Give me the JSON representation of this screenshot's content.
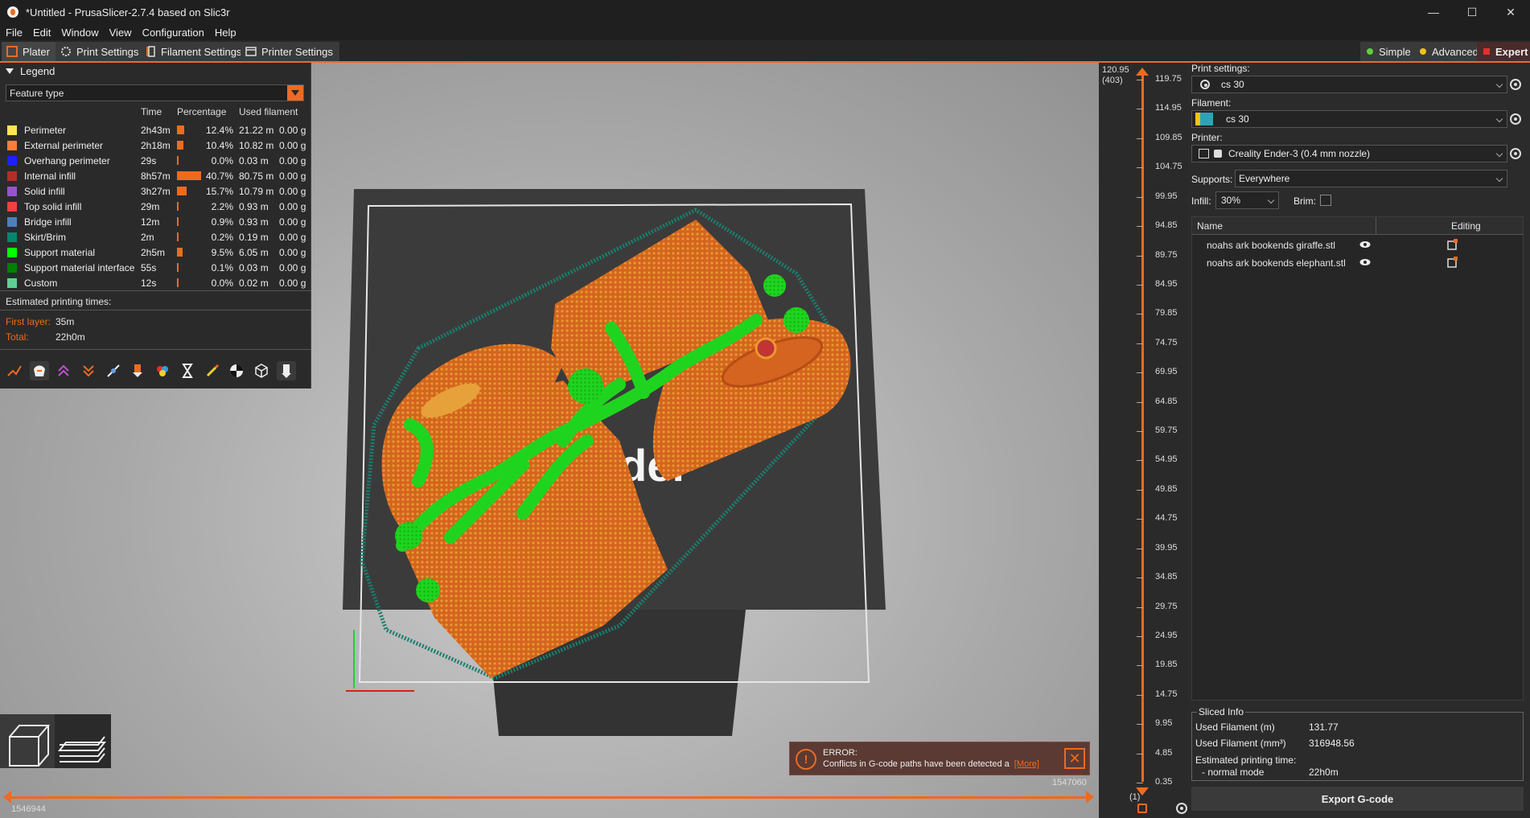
{
  "window": {
    "title": "*Untitled - PrusaSlicer-2.7.4 based on Slic3r",
    "minimize": "—",
    "maximize": "☐",
    "close": "✕"
  },
  "menu": [
    "File",
    "Edit",
    "Window",
    "View",
    "Configuration",
    "Help"
  ],
  "tabs": {
    "plater": "Plater",
    "print_settings": "Print Settings",
    "filament_settings": "Filament Settings",
    "printer_settings": "Printer Settings"
  },
  "modes": {
    "simple": "Simple",
    "advanced": "Advanced",
    "expert": "Expert"
  },
  "colors": {
    "accent": "#ed6b21",
    "simple": "#5fcf3a",
    "advanced": "#f2c21b",
    "expert": "#e03030"
  },
  "legend": {
    "header": "Legend",
    "view_type": "Feature type",
    "columns": {
      "time": "Time",
      "percentage": "Percentage",
      "used_filament": "Used filament"
    },
    "rows": [
      {
        "name": "Perimeter",
        "color": "#ffe64d",
        "time": "2h43m",
        "percent": 12.4,
        "percent_label": "12.4%",
        "length": "21.22 m",
        "weight": "0.00 g"
      },
      {
        "name": "External perimeter",
        "color": "#ff7d38",
        "time": "2h18m",
        "percent": 10.4,
        "percent_label": "10.4%",
        "length": "10.82 m",
        "weight": "0.00 g"
      },
      {
        "name": "Overhang perimeter",
        "color": "#1f1fff",
        "time": "29s",
        "percent": 0.0,
        "percent_label": "0.0%",
        "length": "0.03 m",
        "weight": "0.00 g"
      },
      {
        "name": "Internal infill",
        "color": "#b03029",
        "time": "8h57m",
        "percent": 40.7,
        "percent_label": "40.7%",
        "length": "80.75 m",
        "weight": "0.00 g"
      },
      {
        "name": "Solid infill",
        "color": "#9654cc",
        "time": "3h27m",
        "percent": 15.7,
        "percent_label": "15.7%",
        "length": "10.79 m",
        "weight": "0.00 g"
      },
      {
        "name": "Top solid infill",
        "color": "#f04040",
        "time": "29m",
        "percent": 2.2,
        "percent_label": "2.2%",
        "length": "0.93 m",
        "weight": "0.00 g"
      },
      {
        "name": "Bridge infill",
        "color": "#4d80ba",
        "time": "12m",
        "percent": 0.9,
        "percent_label": "0.9%",
        "length": "0.93 m",
        "weight": "0.00 g"
      },
      {
        "name": "Skirt/Brim",
        "color": "#00876e",
        "time": "2m",
        "percent": 0.2,
        "percent_label": "0.2%",
        "length": "0.19 m",
        "weight": "0.00 g"
      },
      {
        "name": "Support material",
        "color": "#00ff00",
        "time": "2h5m",
        "percent": 9.5,
        "percent_label": "9.5%",
        "length": "6.05 m",
        "weight": "0.00 g"
      },
      {
        "name": "Support material interface",
        "color": "#008000",
        "time": "55s",
        "percent": 0.1,
        "percent_label": "0.1%",
        "length": "0.03 m",
        "weight": "0.00 g"
      },
      {
        "name": "Custom",
        "color": "#5ed194",
        "time": "12s",
        "percent": 0.0,
        "percent_label": "0.0%",
        "length": "0.02 m",
        "weight": "0.00 g"
      }
    ],
    "estimated_label": "Estimated printing times:",
    "first_layer_label": "First layer:",
    "first_layer_value": "35m",
    "total_label": "Total:",
    "total_value": "22h0m"
  },
  "sidebar": {
    "print_settings_label": "Print settings:",
    "print_settings_value": "cs 30",
    "filament_label": "Filament:",
    "filament_value": "cs 30",
    "filament_color": "#2fa3b5",
    "printer_label": "Printer:",
    "printer_value": "Creality Ender-3 (0.4 mm nozzle)",
    "supports_label": "Supports:",
    "supports_value": "Everywhere",
    "infill_label": "Infill:",
    "infill_value": "30%",
    "brim_label": "Brim:"
  },
  "objects": {
    "col_name": "Name",
    "col_editing": "Editing",
    "items": [
      {
        "name": "noahs ark bookends giraffe.stl"
      },
      {
        "name": "noahs ark bookends elephant.stl"
      }
    ]
  },
  "sliced_info": {
    "title": "Sliced Info",
    "used_m_label": "Used Filament (m)",
    "used_m_value": "131.77",
    "used_mm3_label": "Used Filament (mm³)",
    "used_mm3_value": "316948.56",
    "est_label": "Estimated printing time:",
    "normal_label": "- normal mode",
    "normal_value": "22h0m"
  },
  "export_button": "Export G-code",
  "vslider": {
    "top_value": "120.95",
    "top_layer": "(403)",
    "bottom_layer": "(1)",
    "ticks": [
      "119.75",
      "114.95",
      "109.85",
      "104.75",
      "99.95",
      "94.85",
      "89.75",
      "84.95",
      "79.85",
      "74.75",
      "69.95",
      "64.85",
      "59.75",
      "54.95",
      "49.85",
      "44.75",
      "39.95",
      "34.85",
      "29.75",
      "24.95",
      "19.85",
      "14.75",
      "9.95",
      "4.85",
      "0.35"
    ]
  },
  "hslider": {
    "left_value": "1546944",
    "right_value": "1547060"
  },
  "error": {
    "title": "ERROR:",
    "message": "Conflicts in G-code paths have been detected a",
    "more": "[More]"
  },
  "bed_logo_text": "der"
}
